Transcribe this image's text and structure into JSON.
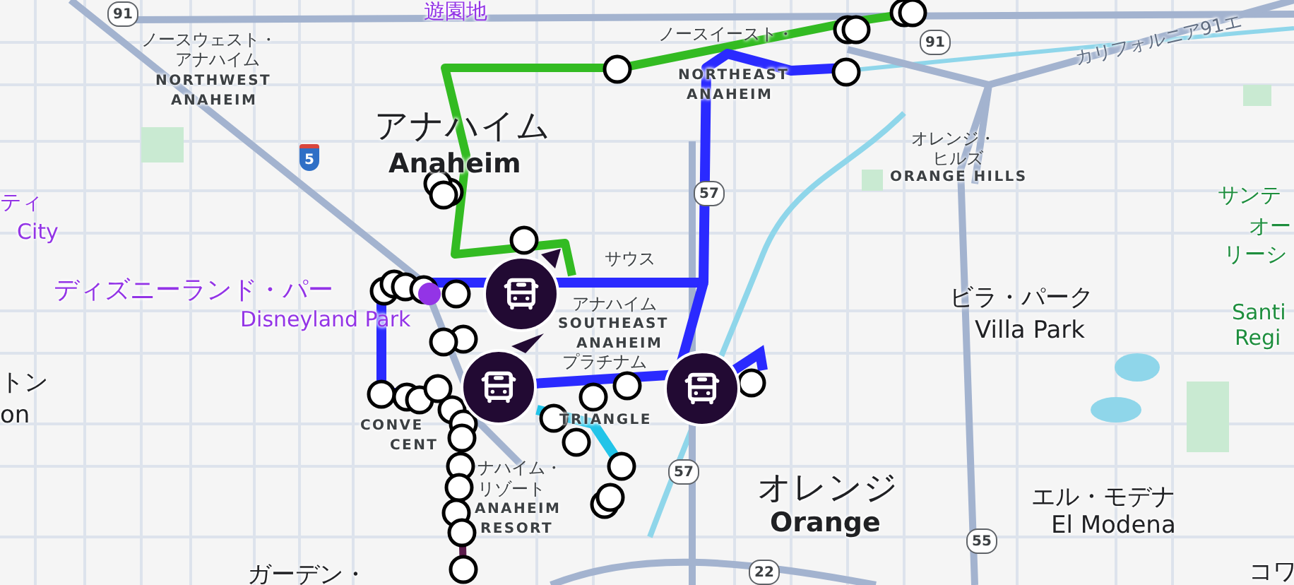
{
  "map": {
    "labels": [
      {
        "kind": "poi",
        "text": "遊園地"
      },
      {
        "kind": "area",
        "text": "ノースウェスト・"
      },
      {
        "kind": "area",
        "text": "アナハイム"
      },
      {
        "kind": "area-en",
        "text": "NORTHWEST"
      },
      {
        "kind": "area-en",
        "text": "ANAHEIM"
      },
      {
        "kind": "city",
        "text": "アナハイム"
      },
      {
        "kind": "city-en",
        "text": "Anaheim"
      },
      {
        "kind": "area",
        "text": "ノースイースト・"
      },
      {
        "kind": "area-en",
        "text": "NORTHEAST"
      },
      {
        "kind": "area-en",
        "text": "ANAHEIM"
      },
      {
        "kind": "area",
        "text": "オレンジ・"
      },
      {
        "kind": "area",
        "text": "ヒルズ"
      },
      {
        "kind": "area-en",
        "text": "ORANGE HILLS"
      },
      {
        "kind": "road",
        "text": "カリフォルニア91エ"
      },
      {
        "kind": "park",
        "text": "サンテ"
      },
      {
        "kind": "park",
        "text": "オー"
      },
      {
        "kind": "park",
        "text": "リーシ"
      },
      {
        "kind": "park",
        "text": "Santi"
      },
      {
        "kind": "park",
        "text": "Regi"
      },
      {
        "kind": "poi",
        "text": "ティ"
      },
      {
        "kind": "poi",
        "text": "City"
      },
      {
        "kind": "poi-big",
        "text": "ディズニーランド・パー"
      },
      {
        "kind": "poi",
        "text": "Disneyland Park"
      },
      {
        "kind": "area",
        "text": "サウス"
      },
      {
        "kind": "area",
        "text": "アナハイム"
      },
      {
        "kind": "area-en",
        "text": "SOUTHEAST"
      },
      {
        "kind": "area-en",
        "text": "ANAHEIM"
      },
      {
        "kind": "area",
        "text": "プラチナム"
      },
      {
        "kind": "area-en",
        "text": "TRIANGLE"
      },
      {
        "kind": "town",
        "text": "トン"
      },
      {
        "kind": "town",
        "text": "on"
      },
      {
        "kind": "area-en",
        "text": "CONVE"
      },
      {
        "kind": "area-en",
        "text": "CENT"
      },
      {
        "kind": "area",
        "text": "ナハイム・"
      },
      {
        "kind": "area",
        "text": "リゾート"
      },
      {
        "kind": "area-en",
        "text": "ANAHEIM"
      },
      {
        "kind": "area-en",
        "text": "RESORT"
      },
      {
        "kind": "town",
        "text": "ガーデン・"
      },
      {
        "kind": "town",
        "text": "ビラ・パーク"
      },
      {
        "kind": "town",
        "text": "Villa Park"
      },
      {
        "kind": "city",
        "text": "オレンジ"
      },
      {
        "kind": "city-en",
        "text": "Orange"
      },
      {
        "kind": "town",
        "text": "エル・モデナ"
      },
      {
        "kind": "town",
        "text": "El Modena"
      },
      {
        "kind": "town",
        "text": "コワ"
      }
    ],
    "shields": [
      {
        "kind": "state",
        "text": "91"
      },
      {
        "kind": "interstate",
        "text": "5"
      },
      {
        "kind": "state",
        "text": "91"
      },
      {
        "kind": "state",
        "text": "57"
      },
      {
        "kind": "state",
        "text": "57"
      },
      {
        "kind": "state",
        "text": "55"
      },
      {
        "kind": "state",
        "text": "22"
      }
    ]
  }
}
